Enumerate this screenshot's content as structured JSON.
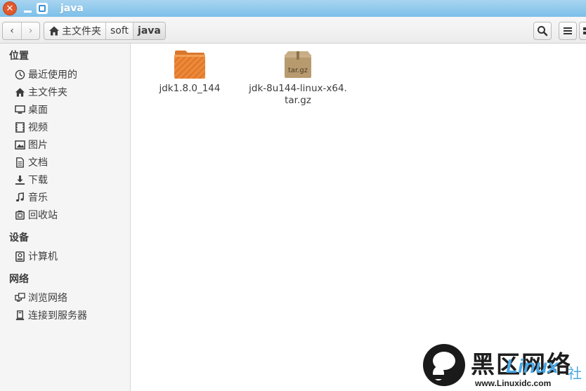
{
  "window": {
    "title": "java",
    "close_glyph": "✕"
  },
  "toolbar": {
    "back_glyph": "‹",
    "forward_glyph": "›",
    "breadcrumbs": [
      {
        "label": "主文件夹",
        "icon": "home-icon"
      },
      {
        "label": "soft"
      },
      {
        "label": "java",
        "active": true
      }
    ]
  },
  "sidebar": {
    "sections": [
      {
        "title": "位置",
        "items": [
          {
            "label": "最近使用的",
            "icon": "recent-clock-icon"
          },
          {
            "label": "主文件夹",
            "icon": "home-icon"
          },
          {
            "label": "桌面",
            "icon": "desktop-icon"
          },
          {
            "label": "视频",
            "icon": "video-icon"
          },
          {
            "label": "图片",
            "icon": "picture-icon"
          },
          {
            "label": "文档",
            "icon": "document-icon"
          },
          {
            "label": "下载",
            "icon": "download-icon"
          },
          {
            "label": "音乐",
            "icon": "music-icon"
          },
          {
            "label": "回收站",
            "icon": "trash-icon"
          }
        ]
      },
      {
        "title": "设备",
        "items": [
          {
            "label": "计算机",
            "icon": "computer-icon"
          }
        ]
      },
      {
        "title": "网络",
        "items": [
          {
            "label": "浏览网络",
            "icon": "network-icon"
          },
          {
            "label": "连接到服务器",
            "icon": "server-icon"
          }
        ]
      }
    ]
  },
  "files": [
    {
      "name": "jdk1.8.0_144",
      "type": "folder",
      "icon": "folder-icon"
    },
    {
      "name_line1": "jdk-8u144-linux-x64.",
      "name_line2": "tar.gz",
      "type": "archive",
      "icon": "archive-icon",
      "badge": "tar.gz"
    }
  ],
  "watermark": {
    "text": "黑区网络",
    "brand": "Linux",
    "suffix": "社",
    "url": "www.Linuxidc.com"
  },
  "colors": {
    "titlebar": "#7dbfe9",
    "close": "#e0582d",
    "folder": "#f08a3c",
    "accent": "#3d8fd1"
  }
}
